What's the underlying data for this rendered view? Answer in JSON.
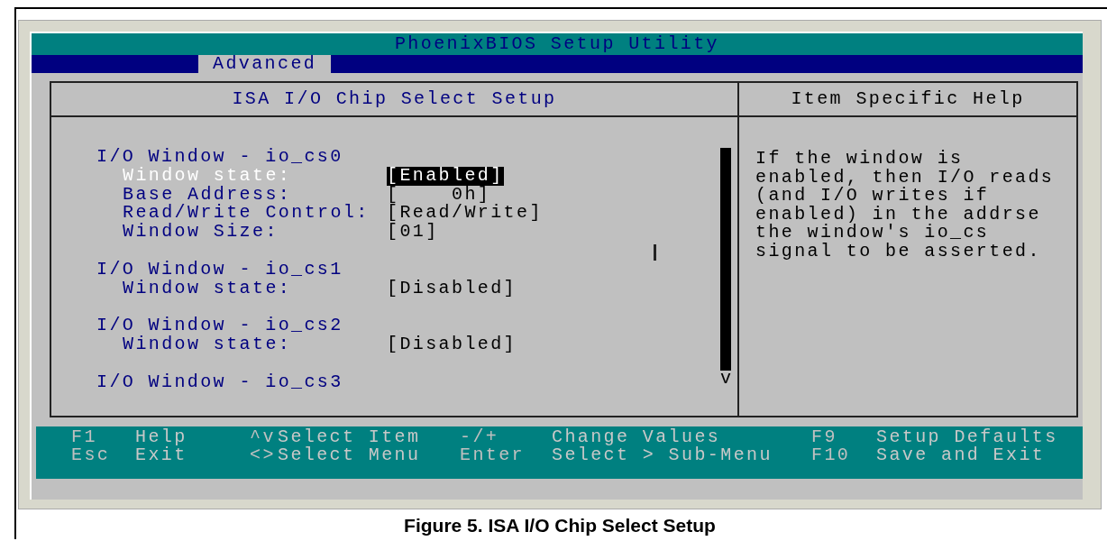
{
  "window": {
    "title": "PhoenixBIOS Setup Utility"
  },
  "menu": [
    {
      "label": "Advanced",
      "selected": true
    }
  ],
  "left_panel": {
    "title": "ISA I/O Chip Select Setup",
    "groups": [
      {
        "heading": "I/O Window - io_cs0",
        "items": [
          {
            "label": "Window state:",
            "value": "[Enabled]",
            "selected": true
          },
          {
            "label": "Base Address:",
            "value": "[    0h]",
            "selected": false
          },
          {
            "label": "Read/Write Control:",
            "value": "[Read/Write]",
            "selected": false
          },
          {
            "label": "Window Size:",
            "value": "[01]",
            "selected": false
          }
        ]
      },
      {
        "heading": "I/O Window - io_cs1",
        "items": [
          {
            "label": "Window state:",
            "value": "[Disabled]",
            "selected": false
          }
        ]
      },
      {
        "heading": "I/O Window - io_cs2",
        "items": [
          {
            "label": "Window state:",
            "value": "[Disabled]",
            "selected": false
          }
        ]
      },
      {
        "heading": "I/O Window - io_cs3"
      }
    ],
    "scroll_arrow": "v"
  },
  "help_panel": {
    "title": "Item Specific Help",
    "text": "If the window is\nenabled, then I/O reads\n(and I/O writes if\nenabled) in the addrse\nthe window's io_cs\nsignal to be asserted."
  },
  "footer": [
    {
      "key": "F1",
      "action": "Help"
    },
    {
      "key": "^v",
      "action": "Select Item"
    },
    {
      "key": "-/+",
      "action": "Change Values"
    },
    {
      "key": "F9",
      "action": "Setup Defaults"
    },
    {
      "key": "Esc",
      "action": "Exit"
    },
    {
      "key": "<>",
      "action": "Select Menu"
    },
    {
      "key": "Enter",
      "action": "Select > Sub-Menu"
    },
    {
      "key": "F10",
      "action": "Save and Exit"
    }
  ],
  "caption": "Figure 5. ISA I/O Chip Select Setup"
}
